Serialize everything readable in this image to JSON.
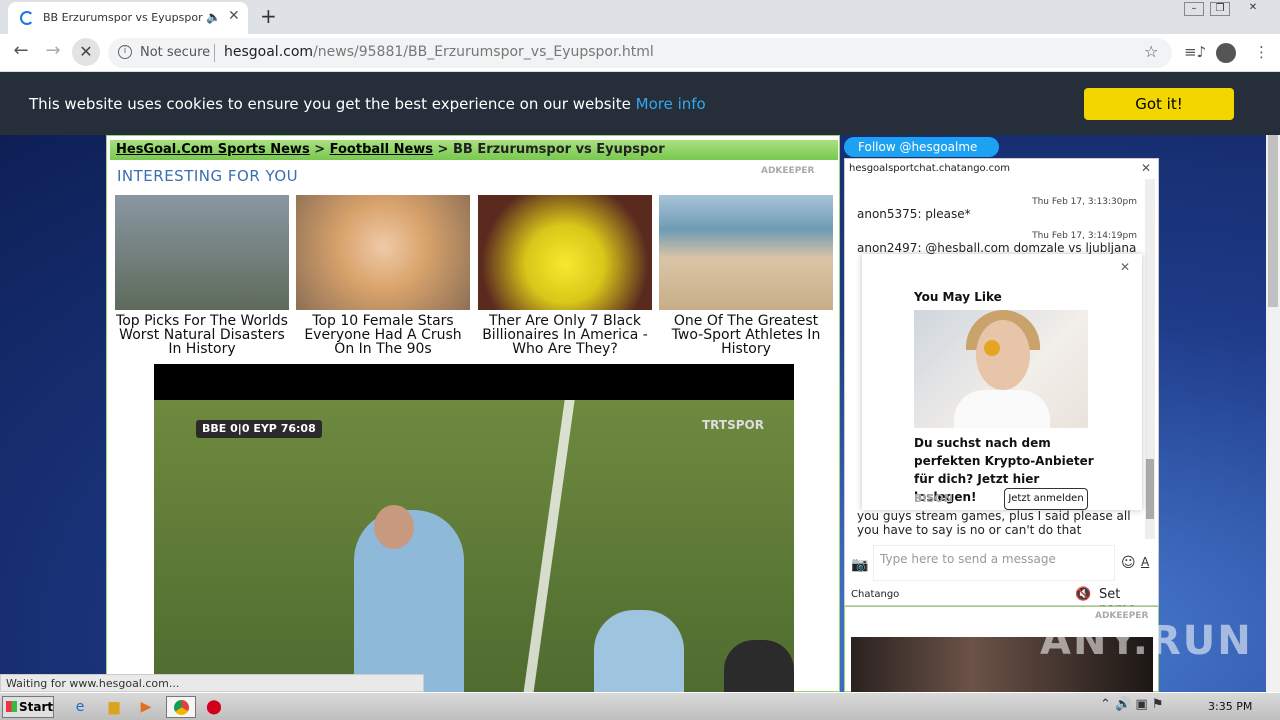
{
  "browser": {
    "tab_title": "BB Erzurumspor vs Eyupspor - H",
    "url_security": "Not secure",
    "url_domain": "hesgoal.com",
    "url_path": "/news/95881/BB_Erzurumspor_vs_Eyupspor.html",
    "status_text": "Waiting for www.hesgoal.com..."
  },
  "cookie": {
    "message": "This website uses cookies to ensure you get the best experience on our website",
    "more_info": "More info",
    "button": "Got it!"
  },
  "breadcrumb": {
    "site": "HesGoal.Com Sports News",
    "sep1": " > ",
    "section": "Football News",
    "sep2": " > ",
    "current": "BB Erzurumspor vs Eyupspor"
  },
  "interesting": {
    "heading": "INTERESTING FOR YOU",
    "badge": "ADKEEPER",
    "cards": [
      {
        "caption": "Top Picks For The Worlds Worst Natural Disasters In History",
        "color": "#7b8a97"
      },
      {
        "caption": "Top 10 Female Stars Everyone Had A Crush On In The 90s",
        "color": "#d7b48c"
      },
      {
        "caption": "Ther Are Only 7 Black Billionaires In America - Who Are They?",
        "color": "#c9b026"
      },
      {
        "caption": "One Of The Greatest Two-Sport Athletes In History",
        "color": "#9ab3c4"
      }
    ]
  },
  "video": {
    "home": "BBE",
    "home_score": "0",
    "away_score": "0",
    "away": "EYP",
    "clock": "76:08",
    "channel": "TRTSPOR"
  },
  "twitter": {
    "follow": "Follow @hesgoalme"
  },
  "chat": {
    "header": "hesgoalsportchat.chatango.com",
    "messages": [
      {
        "time": "Thu Feb 17, 3:13:30pm",
        "text": "anon5375: please*"
      },
      {
        "time": "Thu Feb 17, 3:14:19pm",
        "text": "anon2497: @hesball.com domzale vs ljubljana"
      }
    ],
    "last_text": "you guys stream games, plus I said please all you have to say is no or can't do that",
    "input_placeholder": "Type here to send a message",
    "footer_brand": "Chatango",
    "set_name": "Set name"
  },
  "popup": {
    "heading": "You May Like",
    "text": "Du suchst nach dem perfekten Krypto-Anbieter für dich? Jetzt hier loslegen!",
    "brand": "BISON",
    "button": "Jetzt anmelden"
  },
  "ad_box": {
    "badge": "ADKEEPER"
  },
  "watermark": "ANY.RUN",
  "taskbar": {
    "start": "Start",
    "clock": "3:35 PM"
  }
}
